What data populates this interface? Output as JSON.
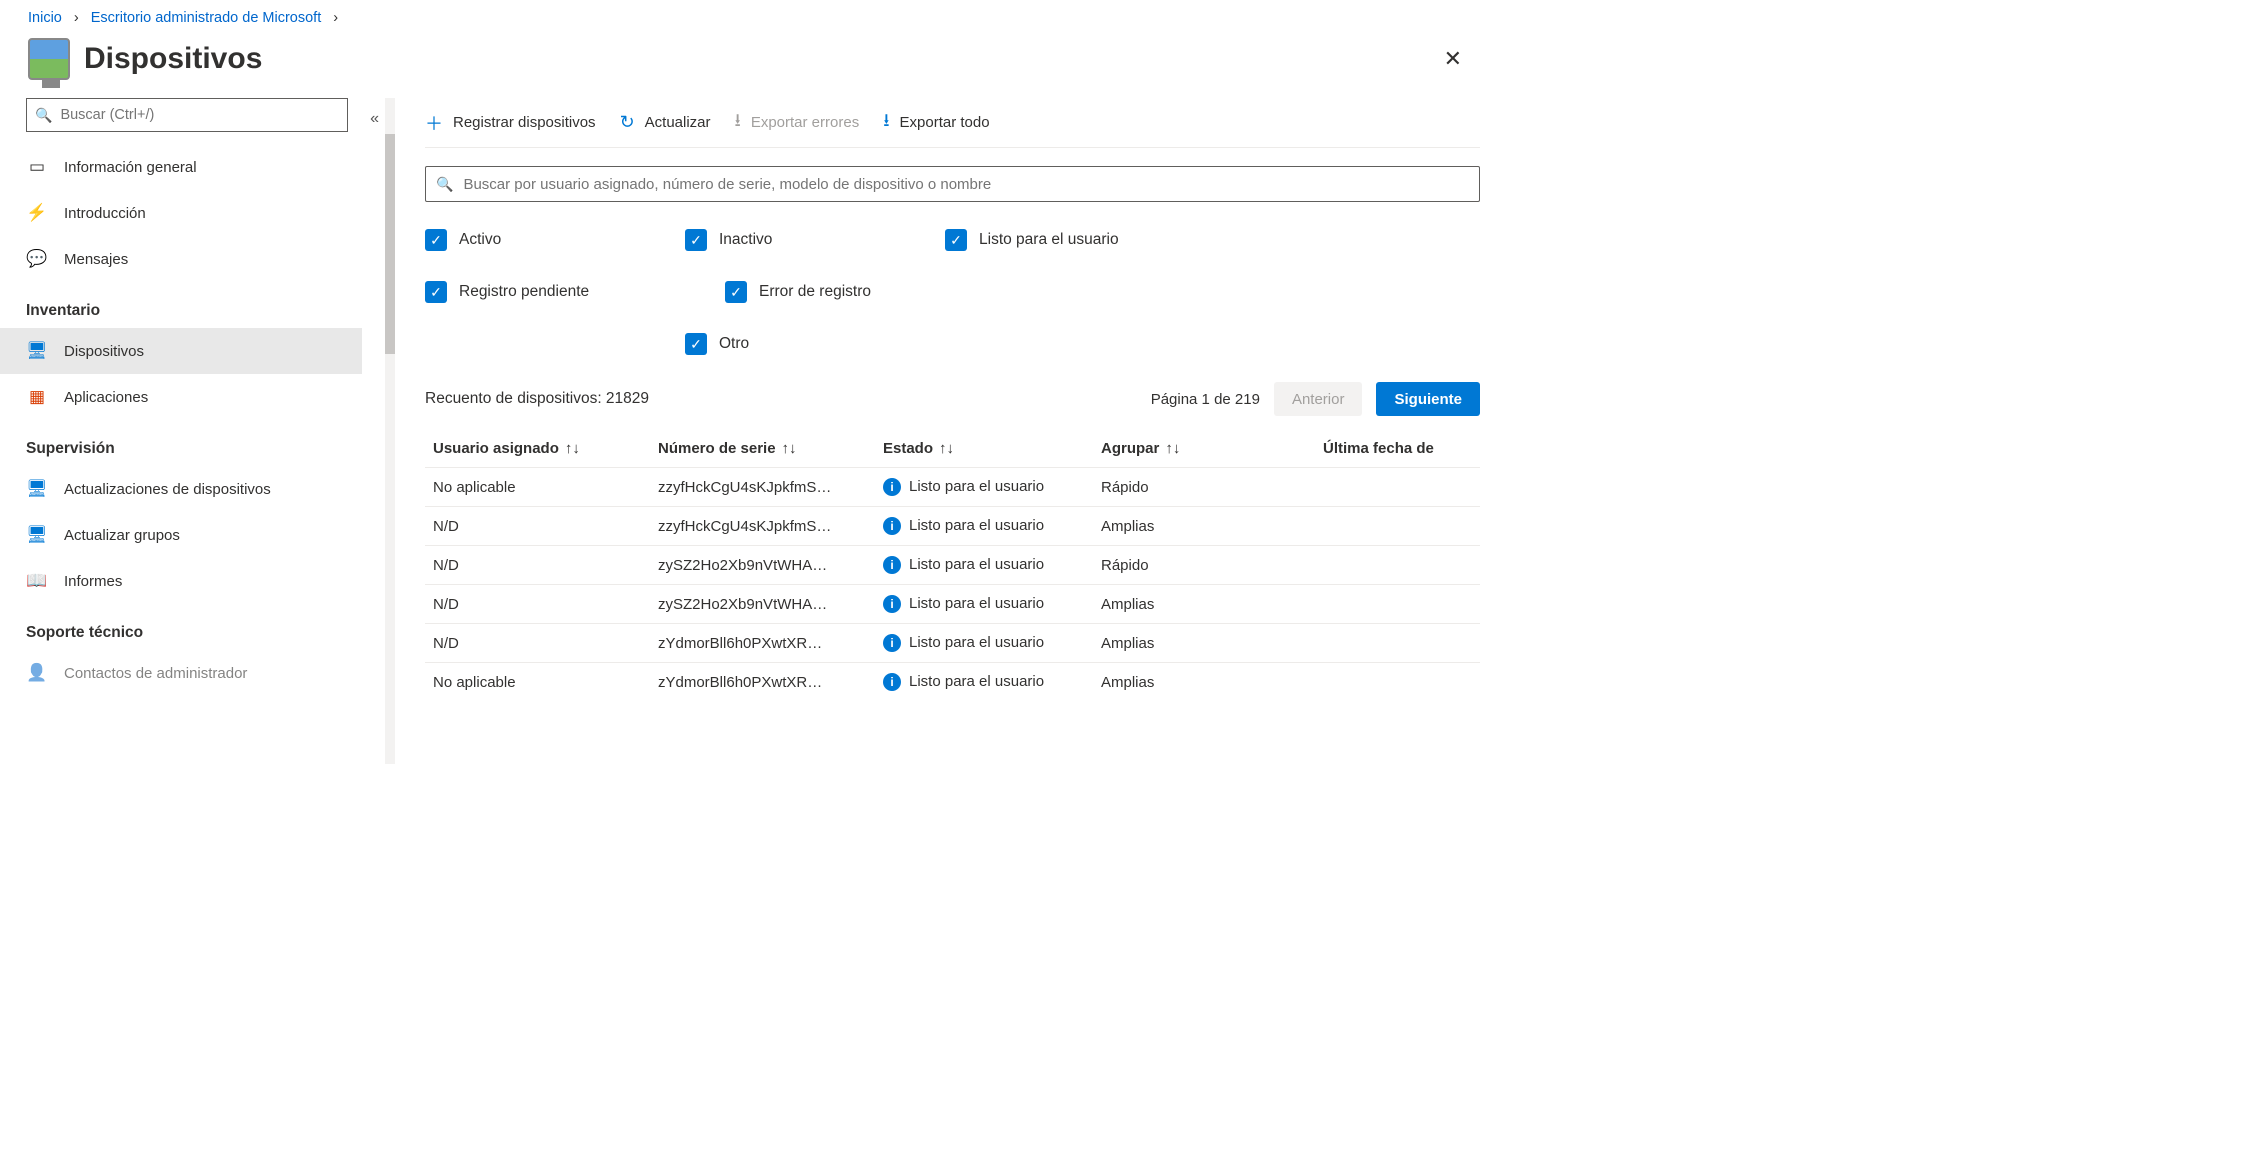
{
  "breadcrumb": {
    "home": "Inicio",
    "parent": "Escritorio administrado de Microsoft"
  },
  "page": {
    "title": "Dispositivos"
  },
  "sidebar": {
    "search_placeholder": "Buscar (Ctrl+/)",
    "items": [
      {
        "label": "Información general"
      },
      {
        "label": "Introducción"
      },
      {
        "label": "Mensajes"
      }
    ],
    "section_inventory": "Inventario",
    "inventory": [
      {
        "label": "Dispositivos",
        "selected": true
      },
      {
        "label": "Aplicaciones"
      }
    ],
    "section_supervision": "Supervisión",
    "supervision": [
      {
        "label": "Actualizaciones de dispositivos"
      },
      {
        "label": "Actualizar grupos"
      },
      {
        "label": "Informes"
      }
    ],
    "section_support": "Soporte técnico",
    "support": [
      {
        "label": "Contactos de administrador"
      }
    ]
  },
  "toolbar": {
    "register": "Registrar dispositivos",
    "refresh": "Actualizar",
    "export_errors": "Exportar errores",
    "export_all": "Exportar todo"
  },
  "main_search": {
    "placeholder": "Buscar por usuario asignado, número de serie, modelo de dispositivo o nombre"
  },
  "filters": {
    "active": "Activo",
    "inactive": "Inactivo",
    "ready": "Listo para el usuario",
    "pending": "Registro pendiente",
    "error": "Error de registro",
    "other": "Otro"
  },
  "count_label": "Recuento de dispositivos: 21829",
  "pager": {
    "page_text": "Página 1 de 219",
    "prev": "Anterior",
    "next": "Siguiente"
  },
  "columns": {
    "user": "Usuario asignado",
    "serial": "Número de serie",
    "status": "Estado",
    "group": "Agrupar",
    "lastdate": "Última fecha de"
  },
  "rows": [
    {
      "user": "No aplicable",
      "serial": "zzyfHckCgU4sKJpkfmS…",
      "status": "Listo para el usuario",
      "group": "Rápido"
    },
    {
      "user": "N/D",
      "serial": "zzyfHckCgU4sKJpkfmS…",
      "status": "Listo para el usuario",
      "group": "Amplias"
    },
    {
      "user": "N/D",
      "serial": "zySZ2Ho2Xb9nVtWHA…",
      "status": "Listo para el usuario",
      "group": "Rápido"
    },
    {
      "user": "N/D",
      "serial": "zySZ2Ho2Xb9nVtWHA…",
      "status": "Listo para el usuario",
      "group": "Amplias"
    },
    {
      "user": "N/D",
      "serial": "zYdmorBll6h0PXwtXR…",
      "status": "Listo para el usuario",
      "group": "Amplias"
    },
    {
      "user": "No aplicable",
      "serial": "zYdmorBll6h0PXwtXR…",
      "status": "Listo para el usuario",
      "group": "Amplias"
    }
  ]
}
